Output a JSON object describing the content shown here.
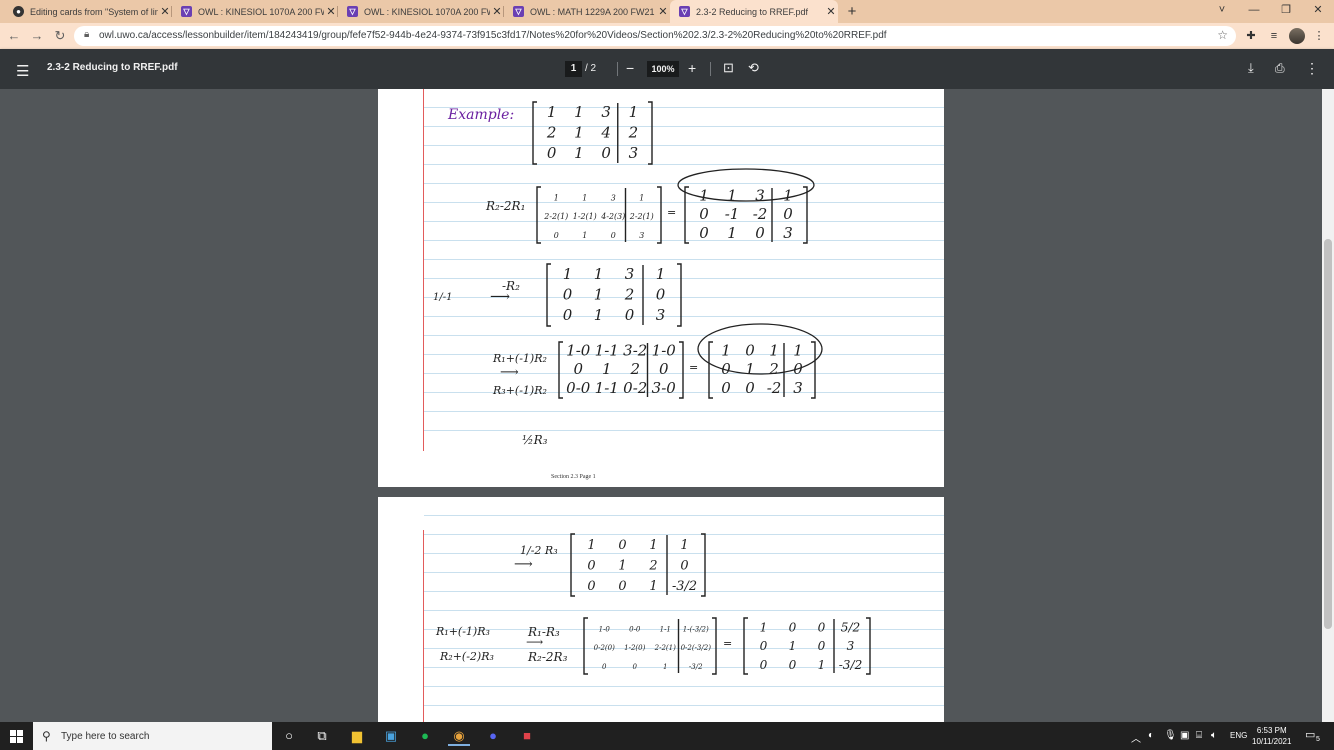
{
  "browser": {
    "tabs": [
      {
        "title": "Editing cards from \"System of lin",
        "icon": "quizlet-icon",
        "active": false
      },
      {
        "title": "OWL : KINESIOL 1070A 200 FW2",
        "icon": "owl-icon",
        "active": false
      },
      {
        "title": "OWL : KINESIOL 1070A 200 FW2",
        "icon": "owl-icon",
        "active": false
      },
      {
        "title": "OWL : MATH 1229A 200 FW21 : ",
        "icon": "owl-icon",
        "active": false
      },
      {
        "title": "2.3-2 Reducing to RREF.pdf",
        "icon": "owl-icon",
        "active": true
      }
    ],
    "new_tab": "+",
    "url": "owl.uwo.ca/access/lessonbuilder/item/184243419/group/fefe7f52-944b-4e24-9374-73f915c3fd17/Notes%20for%20Videos/Section%202.3/2.3-2%20Reducing%20to%20RREF.pdf",
    "window_controls": [
      "˅",
      "—",
      "❐",
      "✕"
    ]
  },
  "pdf": {
    "title": "2.3-2 Reducing to RREF.pdf",
    "current_page": "1",
    "page_total": "/  2",
    "zoom": "100%",
    "footer": "Section 2.3 Page 1"
  },
  "notes": {
    "example_label": "Example:",
    "aug_matrix": [
      [
        "1",
        "1",
        "3",
        "1"
      ],
      [
        "2",
        "1",
        "4",
        "2"
      ],
      [
        "0",
        "1",
        "0",
        "3"
      ]
    ],
    "step1_op": "R₂-2R₁",
    "step1_mid": [
      [
        "1",
        "1",
        "3",
        "1"
      ],
      [
        "2-2(1)",
        "1-2(1)",
        "4-2(3)",
        "2-2(1)"
      ],
      [
        "0",
        "1",
        "0",
        "3"
      ]
    ],
    "step1_res": [
      [
        "1",
        "1",
        "3",
        "1"
      ],
      [
        "0",
        "-1",
        "-2",
        "0"
      ],
      [
        "0",
        "1",
        "0",
        "3"
      ]
    ],
    "margin_note": "1/-1",
    "step2_op": "-R₂",
    "step2_res": [
      [
        "1",
        "1",
        "3",
        "1"
      ],
      [
        "0",
        "1",
        "2",
        "0"
      ],
      [
        "0",
        "1",
        "0",
        "3"
      ]
    ],
    "step3_op1": "R₁+(-1)R₂",
    "step3_op2": "R₃+(-1)R₂",
    "step3_mid": [
      [
        "1-0",
        "1-1",
        "3-2",
        "1-0"
      ],
      [
        "0",
        "1",
        "2",
        "0"
      ],
      [
        "0-0",
        "1-1",
        "0-2",
        "3-0"
      ]
    ],
    "step3_res": [
      [
        "1",
        "0",
        "1",
        "1"
      ],
      [
        "0",
        "1",
        "2",
        "0"
      ],
      [
        "0",
        "0",
        "-2",
        "3"
      ]
    ],
    "step4_op": "½R₃",
    "step4_op_p2": "1/-2 R₃",
    "step4_res": [
      [
        "1",
        "0",
        "1",
        "1"
      ],
      [
        "0",
        "1",
        "2",
        "0"
      ],
      [
        "0",
        "0",
        "1",
        "-3/2"
      ]
    ],
    "step5_op_left1": "R₁+(-1)R₃",
    "step5_op_left2": "R₂+(-2)R₃",
    "step5_op1": "R₁-R₃",
    "step5_op2": "R₂-2R₃",
    "step5_mid": [
      [
        "1-0",
        "0-0",
        "1-1",
        "1-(-3/2)"
      ],
      [
        "0-2(0)",
        "1-2(0)",
        "2-2(1)",
        "0-2(-3/2)"
      ],
      [
        "0",
        "0",
        "1",
        "-3/2"
      ]
    ],
    "step5_res": [
      [
        "1",
        "0",
        "0",
        "5/2"
      ],
      [
        "0",
        "1",
        "0",
        "3"
      ],
      [
        "0",
        "0",
        "1",
        "-3/2"
      ]
    ]
  },
  "taskbar": {
    "search_placeholder": "Type here to search",
    "language": "ENG",
    "time": "6:53 PM",
    "date": "10/11/2021",
    "notifications": "5"
  }
}
